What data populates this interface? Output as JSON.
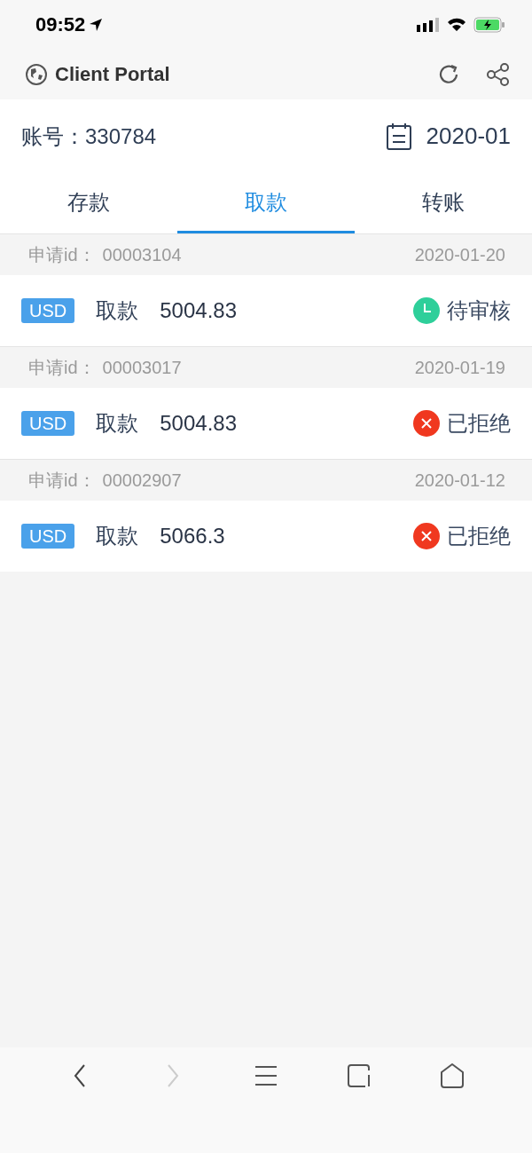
{
  "status_bar": {
    "time": "09:52"
  },
  "app_bar": {
    "title": "Client Portal"
  },
  "account": {
    "label": "账号：",
    "number": "330784",
    "month": "2020-01"
  },
  "tabs": [
    {
      "label": "存款",
      "selected": false
    },
    {
      "label": "取款",
      "selected": true
    },
    {
      "label": "转账",
      "selected": false
    }
  ],
  "records": [
    {
      "id_label": "申请id：",
      "id": "00003104",
      "date": "2020-01-20",
      "currency": "USD",
      "type": "取款",
      "amount": "5004.83",
      "status": {
        "kind": "pending",
        "label": "待审核"
      }
    },
    {
      "id_label": "申请id：",
      "id": "00003017",
      "date": "2020-01-19",
      "currency": "USD",
      "type": "取款",
      "amount": "5004.83",
      "status": {
        "kind": "rejected",
        "label": "已拒绝"
      }
    },
    {
      "id_label": "申请id：",
      "id": "00002907",
      "date": "2020-01-12",
      "currency": "USD",
      "type": "取款",
      "amount": "5066.3",
      "status": {
        "kind": "rejected",
        "label": "已拒绝"
      }
    }
  ],
  "browser_toolbar": {
    "back_disabled": false,
    "forward_disabled": true
  }
}
